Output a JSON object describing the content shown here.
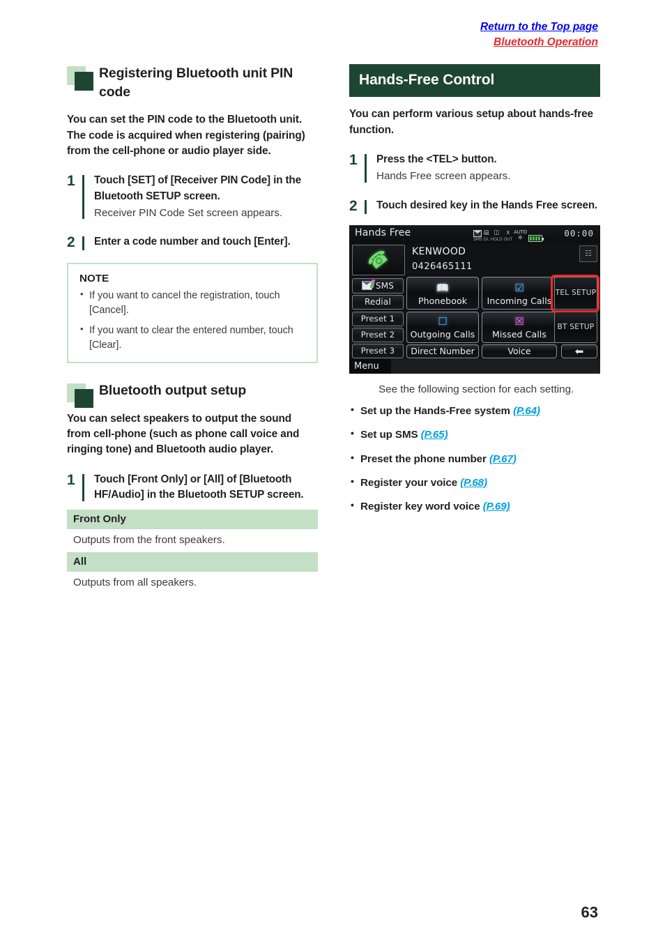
{
  "header": {
    "return_link": "Return to the Top page",
    "section_link": "Bluetooth Operation"
  },
  "left_column": {
    "section1": {
      "heading": "Registering Bluetooth unit PIN code",
      "lead": "You can set the PIN code to the Bluetooth unit. The code is acquired when registering (pairing) from the cell-phone or audio player side.",
      "steps": [
        {
          "num": "1",
          "title": "Touch [SET] of [Receiver PIN Code] in the Bluetooth SETUP screen.",
          "sub": "Receiver PIN Code Set screen appears."
        },
        {
          "num": "2",
          "title": "Enter a code number and touch [Enter].",
          "sub": ""
        }
      ],
      "note": {
        "title": "NOTE",
        "items": [
          "If you want to cancel the registration, touch [Cancel].",
          "If you want to clear the entered number, touch [Clear]."
        ]
      }
    },
    "section2": {
      "heading": "Bluetooth output setup",
      "lead": "You can select speakers to output the sound from cell-phone (such as phone call voice and ringing tone) and Bluetooth audio player.",
      "steps": [
        {
          "num": "1",
          "title": "Touch [Front Only] or [All] of [Bluetooth HF/Audio] in the Bluetooth SETUP screen.",
          "sub": ""
        }
      ],
      "table": [
        {
          "name": "Front Only",
          "desc": "Outputs from the front speakers."
        },
        {
          "name": "All",
          "desc": "Outputs from all speakers."
        }
      ]
    }
  },
  "right_column": {
    "band_heading": "Hands-Free Control",
    "lead": "You can perform various setup about hands-free function.",
    "steps": [
      {
        "num": "1",
        "title": "Press the <TEL> button.",
        "sub": "Hands Free screen appears."
      },
      {
        "num": "2",
        "title": "Touch desired key in the Hands Free screen.",
        "sub": ""
      }
    ],
    "device": {
      "title": "Hands Free",
      "status": [
        {
          "glyph": "envelope",
          "label": "SMS"
        },
        {
          "glyph": "dl",
          "label": "DL"
        },
        {
          "glyph": "hold",
          "label": "HOLD"
        },
        {
          "glyph": "antenna",
          "label": "OUT"
        },
        {
          "glyph": "auto-roam",
          "label": "AUTO"
        },
        {
          "glyph": "battery",
          "label": ""
        }
      ],
      "clock": "00:00",
      "device_name": "KENWOOD",
      "phone_number": "0426465111",
      "left_keys": [
        "SMS",
        "Redial",
        "Preset 1",
        "Preset 2",
        "Preset 3"
      ],
      "grid_buttons": [
        "Phonebook",
        "Incoming Calls",
        "Outgoing Calls",
        "Missed Calls",
        "Direct Number",
        "Voice"
      ],
      "setup_buttons": [
        "TEL SETUP",
        "BT SETUP"
      ],
      "menu_label": "Menu",
      "highlighted_button": "TEL SETUP",
      "highlight_color": "#ee2a2a"
    },
    "ref_intro": "See the following section for each setting.",
    "ref_items": [
      {
        "text": "Set up the Hands-Free system",
        "page": "(P.64)"
      },
      {
        "text": "Set up SMS",
        "page": "(P.65)"
      },
      {
        "text": "Preset the phone number",
        "page": "(P.67)"
      },
      {
        "text": "Register your voice",
        "page": "(P.68)"
      },
      {
        "text": "Register key word voice",
        "page": "(P.69)"
      }
    ]
  },
  "footer": {
    "page_number": "63"
  },
  "colors": {
    "dark_green": "#1d4632",
    "light_green": "#c3dfc6",
    "link_blue": "#0c9ad6",
    "link_red": "#e8262a",
    "ref_cyan": "#00a0df"
  }
}
